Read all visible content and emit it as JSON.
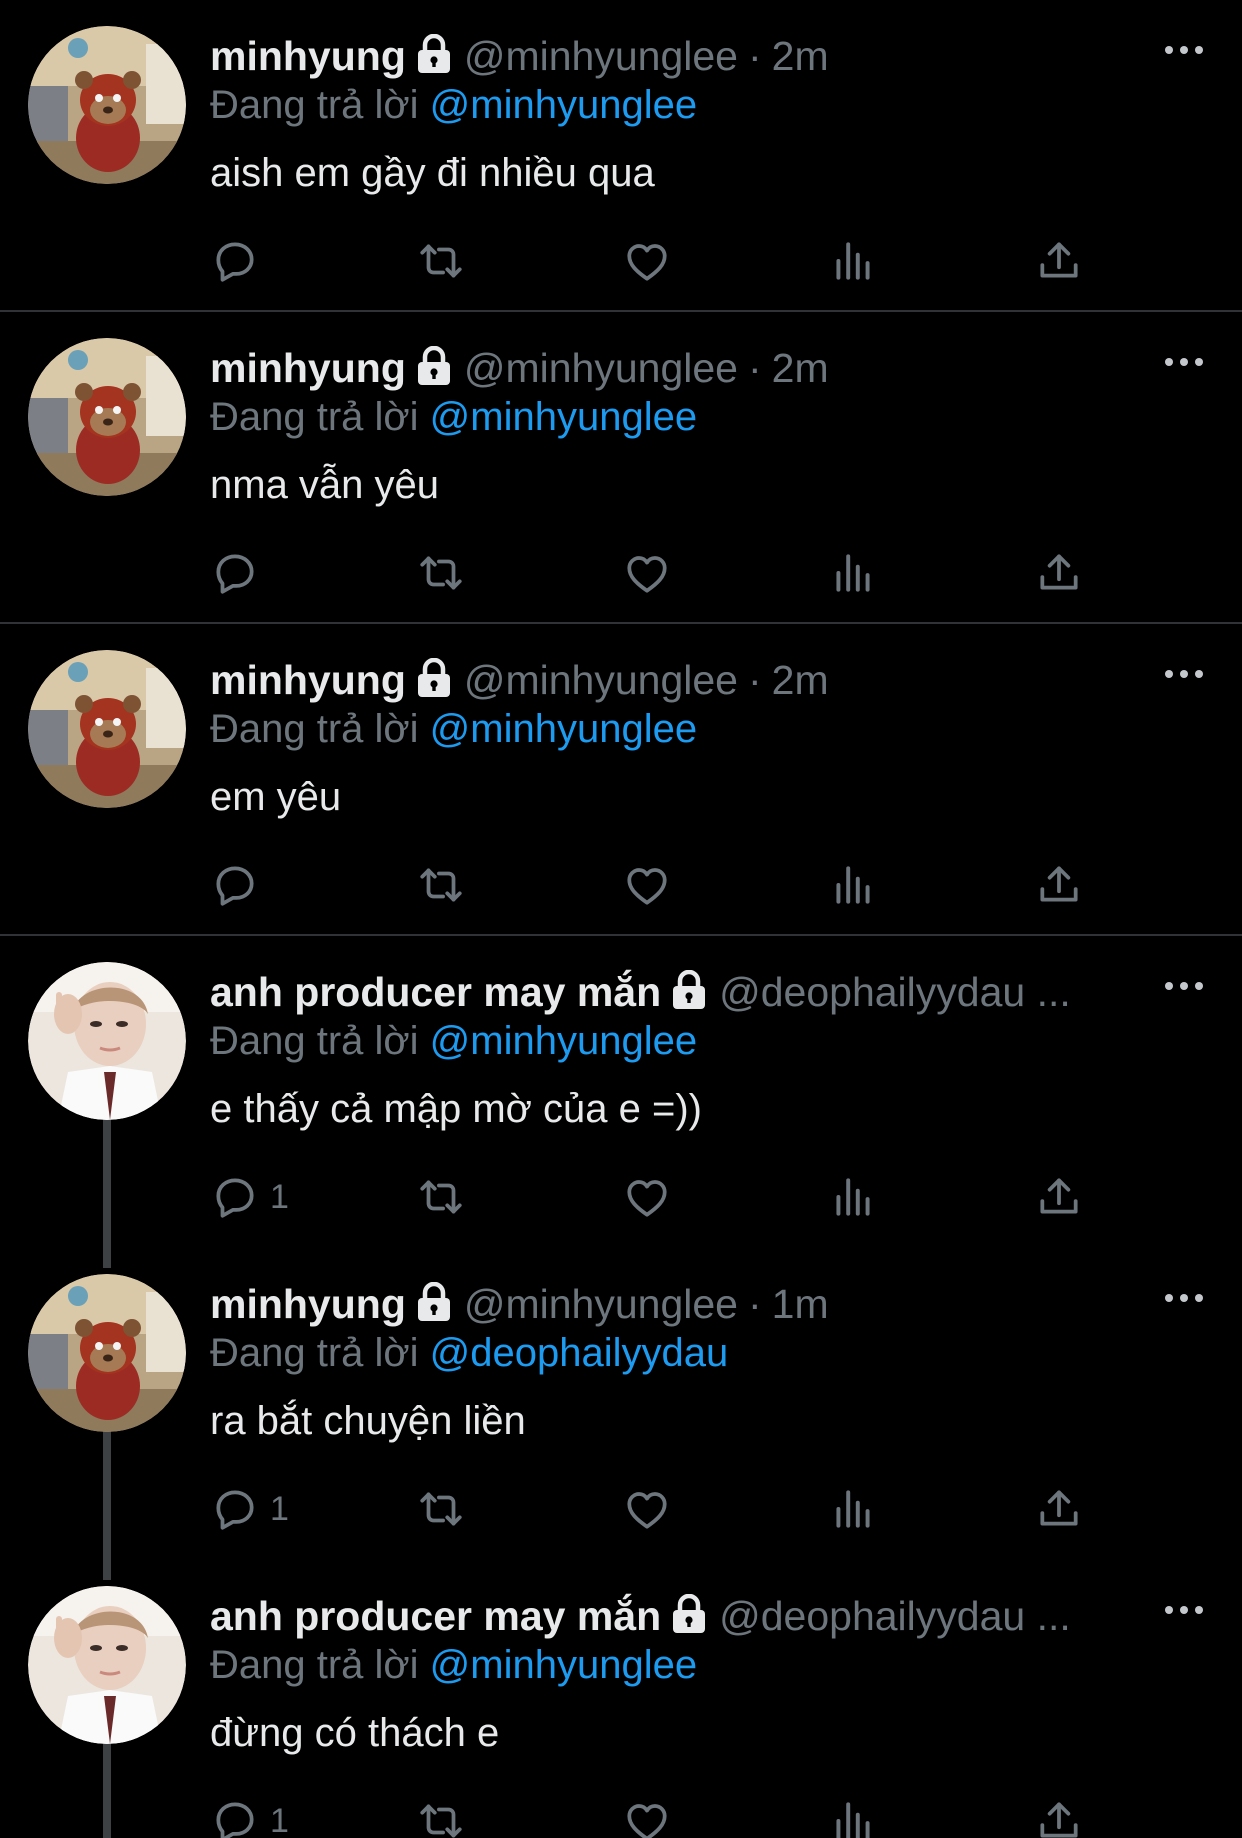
{
  "reply_prefix": "Đang trả lời",
  "tweets": [
    {
      "name": "minhyung",
      "handle": "@minhyunglee",
      "sep": "·",
      "time": "2m",
      "reply_to": "@minhyunglee",
      "text": "aish em gầy đi nhiều qua",
      "reply_count": "",
      "avatar": "bear"
    },
    {
      "name": "minhyung",
      "handle": "@minhyunglee",
      "sep": "·",
      "time": "2m",
      "reply_to": "@minhyunglee",
      "text": "nma vẫn yêu",
      "reply_count": "",
      "avatar": "bear"
    },
    {
      "name": "minhyung",
      "handle": "@minhyunglee",
      "sep": "·",
      "time": "2m",
      "reply_to": "@minhyunglee",
      "text": "em yêu",
      "reply_count": "",
      "avatar": "bear"
    },
    {
      "name": "anh producer may mắn",
      "handle": "@deophailyydau ...",
      "sep": "",
      "time": "",
      "reply_to": "@minhyunglee",
      "text": "e thấy cả mập mờ của e =))",
      "reply_count": "1",
      "avatar": "person"
    },
    {
      "name": "minhyung",
      "handle": "@minhyunglee",
      "sep": "·",
      "time": "1m",
      "reply_to": "@deophailyydau",
      "text": "ra bắt chuyện liền",
      "reply_count": "1",
      "avatar": "bear"
    },
    {
      "name": "anh producer may mắn",
      "handle": "@deophailyydau ...",
      "sep": "",
      "time": "",
      "reply_to": "@minhyunglee",
      "text": "đừng có thách e",
      "reply_count": "1",
      "avatar": "person"
    }
  ],
  "colors": {
    "background": "#000000",
    "mention": "#1d9bf0",
    "muted": "#6e767d",
    "divider": "#2f3336"
  },
  "icons": [
    "lock-icon",
    "more-icon",
    "reply-icon",
    "retweet-icon",
    "like-icon",
    "views-icon",
    "share-icon"
  ]
}
